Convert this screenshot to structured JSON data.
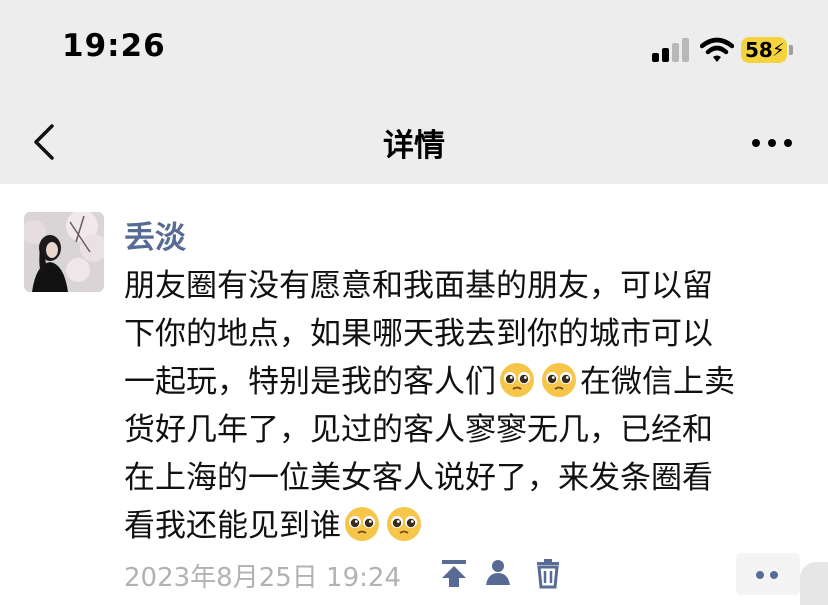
{
  "status_bar": {
    "time": "19:26",
    "battery": "58"
  },
  "nav": {
    "title": "详情"
  },
  "post": {
    "author": "丢淡",
    "lines": [
      "朋友圈有没有愿意和我面基的朋友，可以留",
      "下你的地点，如果哪天我去到你的城市可以",
      "一起玩，特别是我的客人们",
      "在微信上卖",
      "货好几年了，见过的客人寥寥无几，已经和",
      "在上海的一位美女客人说好了，来发条圈看",
      "看我还能见到谁"
    ],
    "emoji": "pleading-face",
    "timestamp": "2023年8月25日 19:24"
  },
  "icons": [
    "back-arrow-icon",
    "more-icon",
    "pin-top-icon",
    "people-icon",
    "trash-icon",
    "comment-more-icon"
  ]
}
